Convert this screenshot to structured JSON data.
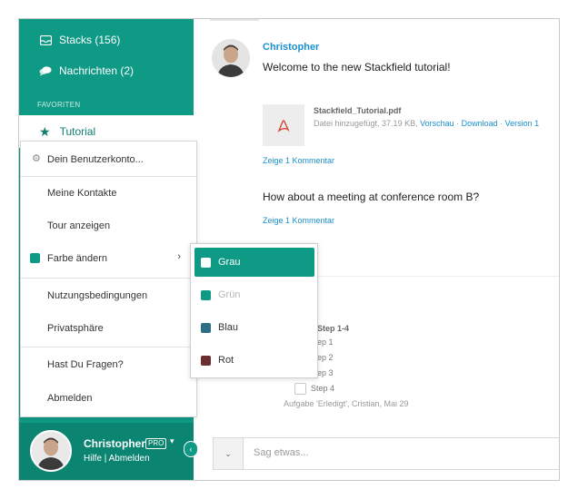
{
  "sidebar": {
    "stacks_label": "Stacks (156)",
    "messages_label": "Nachrichten (2)",
    "favorites_heading": "FAVORITEN",
    "tutorial_label": "Tutorial"
  },
  "user": {
    "name": "Christopher",
    "badge": "PRO",
    "help_link": "Hilfe",
    "links_separator": " | ",
    "logout_link": "Abmelden"
  },
  "account_menu": {
    "items": [
      {
        "label": "Dein Benutzerkonto..."
      },
      {
        "label": "Meine Kontakte"
      },
      {
        "label": "Tour anzeigen"
      },
      {
        "label": "Farbe ändern"
      },
      {
        "label": "Nutzungsbedingungen"
      },
      {
        "label": "Privatsphäre"
      },
      {
        "label": "Hast Du Fragen?"
      },
      {
        "label": "Abmelden"
      }
    ]
  },
  "color_menu": {
    "items": [
      {
        "label": "Grau",
        "color": "#ffffff",
        "state": "selected"
      },
      {
        "label": "Grün",
        "color": "#0f9a86",
        "state": "disabled"
      },
      {
        "label": "Blau",
        "color": "#2a6f86",
        "state": "normal"
      },
      {
        "label": "Rot",
        "color": "#6b2d2d",
        "state": "normal"
      }
    ]
  },
  "feed": {
    "author": "Christopher",
    "message1": "Welcome to the new Stackfield tutorial!",
    "file": {
      "name": "Stackfield_Tutorial.pdf",
      "meta": "Datei hinzugefügt, 37.19 KB, ",
      "preview": "Vorschau",
      "sep1": " · ",
      "download": "Download",
      "sep2": " · ",
      "version": "Version 1",
      "icon": "pdf-icon"
    },
    "comment_link_1": "Zeige 1 Kommentar",
    "message2": "How about a meeting at conference room B?",
    "comment_link_2": "Zeige 1 Kommentar",
    "task": {
      "title": "Step 1-4",
      "steps": [
        "ep 1",
        "ep 2",
        "ep 3",
        "Step 4"
      ],
      "meta": "Aufgabe 'Erledigt', Cristian, Mai 29"
    }
  },
  "composer": {
    "placeholder": "Sag etwas..."
  },
  "colors": {
    "accent": "#0f9a86",
    "accent_dark": "#0c8472",
    "link": "#1a8fd0"
  }
}
